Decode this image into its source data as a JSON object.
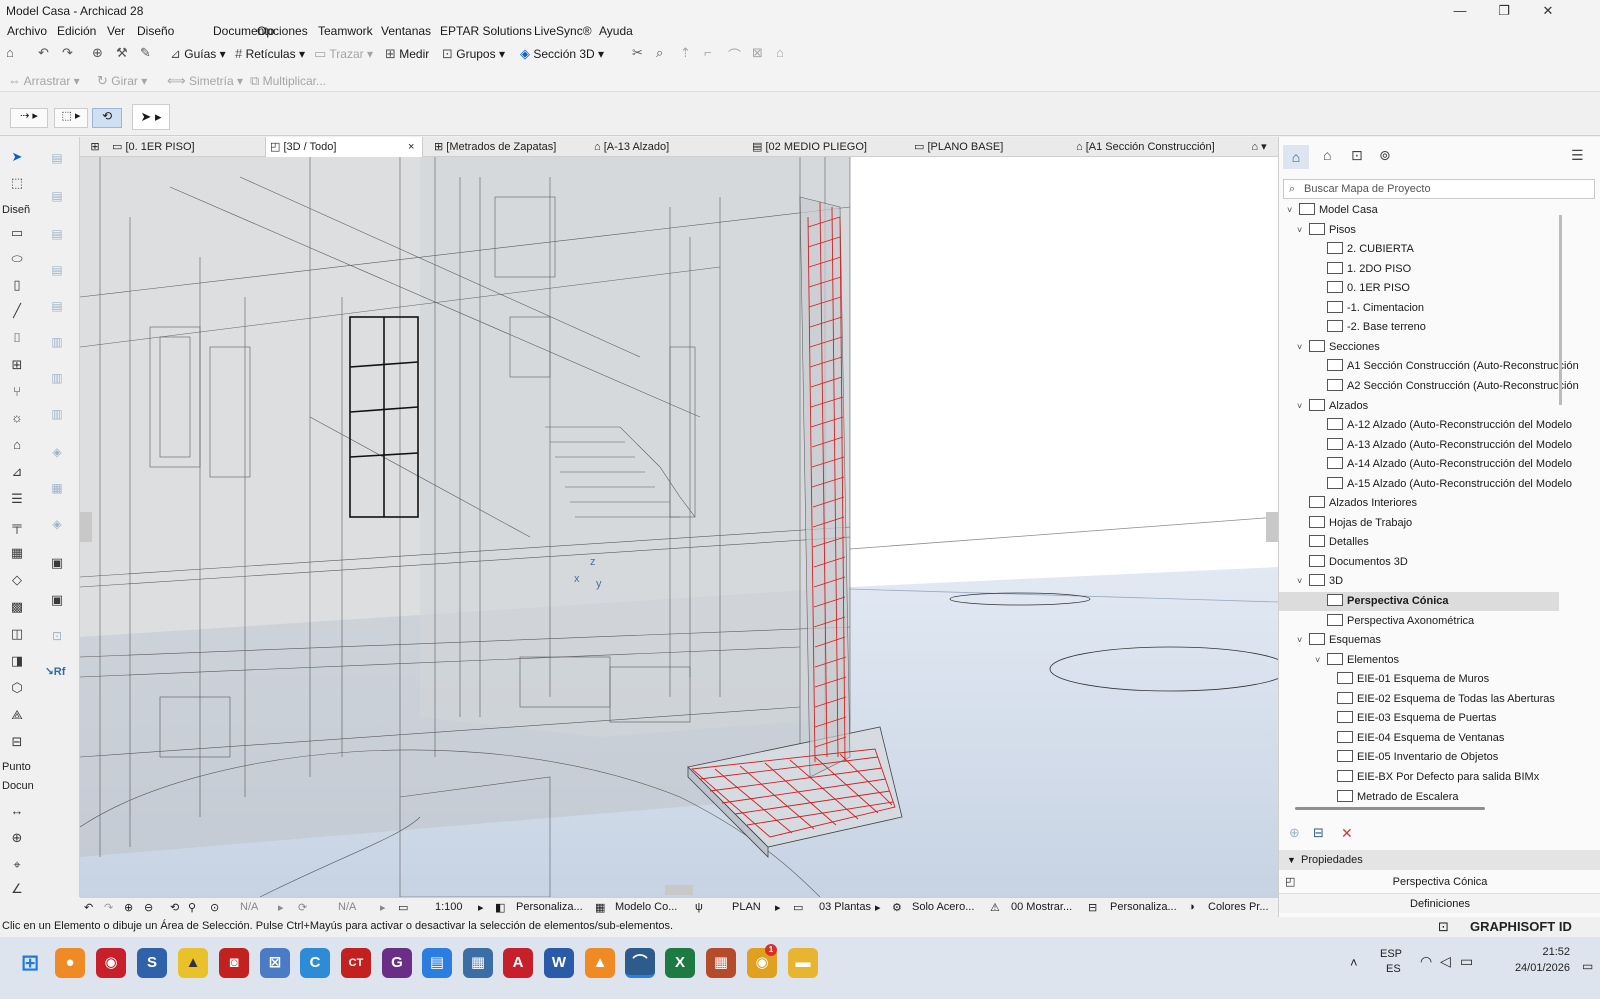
{
  "window": {
    "title": "Model Casa - Archicad 28",
    "minimize": "—",
    "maximize": "❐",
    "close": "✕"
  },
  "menu": [
    "Archivo",
    "Edición",
    "Ver",
    "Diseño",
    "Documento",
    "Opciones",
    "Teamwork",
    "Ventanas",
    "EPTAR Solutions",
    "LiveSync®",
    "Ayuda"
  ],
  "toolbar1": {
    "guides": "Guías",
    "grids": "Retículas",
    "trace": "Trazar",
    "measure": "Medir",
    "groups": "Grupos",
    "section3d": "Sección 3D"
  },
  "toolbar2": {
    "drag": "Arrastrar",
    "rotate": "Girar",
    "mirror": "Simetría",
    "multiply": "Multiplicar..."
  },
  "left_sections": {
    "design": "Diseñ",
    "point": "Punto",
    "document": "Docun"
  },
  "tabs": [
    {
      "label": "[0. 1ER PISO]"
    },
    {
      "label": "[3D / Todo]",
      "active": true,
      "close": "×"
    },
    {
      "label": "[Metrados de Zapatas]"
    },
    {
      "label": "[A-13 Alzado]"
    },
    {
      "label": "[02 MEDIO PLIEGO]"
    },
    {
      "label": "[PLANO BASE]"
    },
    {
      "label": "[A1 Sección Construcción]"
    }
  ],
  "viewport": {
    "axis_x": "x",
    "axis_y": "y",
    "axis_z": "z"
  },
  "bottombar": {
    "zoom1": "N/A",
    "zoom2": "N/A",
    "scale": "1:100",
    "layer": "Personaliza...",
    "model": "Modelo Co...",
    "plan": "PLAN",
    "floors": "03 Plantas",
    "solo": "Solo Acero...",
    "show": "00 Mostrar...",
    "custom": "Personaliza...",
    "colors": "Colores Pr..."
  },
  "status": {
    "message": "Clic en un Elemento o dibuje un Área de Selección. Pulse Ctrl+Mayús para activar o desactivar la selección de elementos/sub-elementos.",
    "brand": "GRAPHISOFT ID"
  },
  "navigator": {
    "search_placeholder": "Buscar Mapa de Proyecto",
    "tree": [
      {
        "label": "Model Casa",
        "level": 0,
        "arrow": "˅"
      },
      {
        "label": "Pisos",
        "level": 1,
        "arrow": "˅"
      },
      {
        "label": "2. CUBIERTA",
        "level": 2
      },
      {
        "label": "1. 2DO PISO",
        "level": 2
      },
      {
        "label": "0. 1ER PISO",
        "level": 2
      },
      {
        "label": "-1. Cimentacion",
        "level": 2
      },
      {
        "label": "-2. Base terreno",
        "level": 2
      },
      {
        "label": "Secciones",
        "level": 1,
        "arrow": "˅"
      },
      {
        "label": "A1 Sección Construcción (Auto-Reconstrucción",
        "level": 2
      },
      {
        "label": "A2 Sección Construcción (Auto-Reconstrucción",
        "level": 2
      },
      {
        "label": "Alzados",
        "level": 1,
        "arrow": "˅"
      },
      {
        "label": "A-12 Alzado (Auto-Reconstrucción del Modelo",
        "level": 2
      },
      {
        "label": "A-13 Alzado (Auto-Reconstrucción del Modelo",
        "level": 2
      },
      {
        "label": "A-14 Alzado (Auto-Reconstrucción del Modelo",
        "level": 2
      },
      {
        "label": "A-15 Alzado (Auto-Reconstrucción del Modelo",
        "level": 2
      },
      {
        "label": "Alzados Interiores",
        "level": 1
      },
      {
        "label": "Hojas de Trabajo",
        "level": 1
      },
      {
        "label": "Detalles",
        "level": 1
      },
      {
        "label": "Documentos 3D",
        "level": 1
      },
      {
        "label": "3D",
        "level": 1,
        "arrow": "˅"
      },
      {
        "label": "Perspectiva Cónica",
        "level": 2,
        "selected": true
      },
      {
        "label": "Perspectiva Axonométrica",
        "level": 2
      },
      {
        "label": "Esquemas",
        "level": 1,
        "arrow": "˅"
      },
      {
        "label": "Elementos",
        "level": 2,
        "arrow": "˅"
      },
      {
        "label": "EIE-01 Esquema de Muros",
        "level": 3
      },
      {
        "label": "EIE-02 Esquema de Todas las Aberturas",
        "level": 3
      },
      {
        "label": "EIE-03 Esquema de Puertas",
        "level": 3
      },
      {
        "label": "EIE-04 Esquema de Ventanas",
        "level": 3
      },
      {
        "label": "EIE-05 Inventario de Objetos",
        "level": 3
      },
      {
        "label": "EIE-BX Por Defecto para salida BIMx",
        "level": 3
      },
      {
        "label": "Metrado de Escalera",
        "level": 3
      }
    ],
    "properties_header": "Propiedades",
    "properties_value": "Perspectiva Cónica",
    "definitions": "Definiciones"
  },
  "taskbar": {
    "keyboard_lang": "ESP",
    "keyboard_region": "ES",
    "time": "21:52",
    "date": "24/01/2026",
    "chrome_badge": "1"
  },
  "colors": {
    "rebar": "#d42020",
    "accent": "#0a64c8",
    "selection": "#dcdcdc"
  }
}
